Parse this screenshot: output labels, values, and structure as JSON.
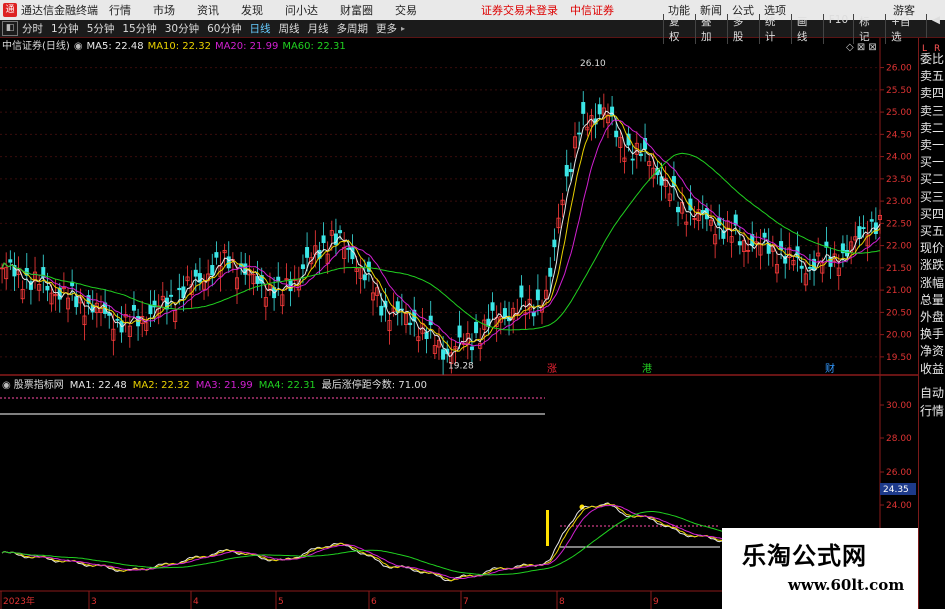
{
  "titlebar": {
    "logo": "通",
    "app_title": "通达信金融终端",
    "menus": [
      "行情",
      "市场",
      "资讯",
      "发现",
      "问小达",
      "财富圈",
      "交易"
    ],
    "warning": "证券交易未登录",
    "broker": "中信证券",
    "right_menus": [
      "功能",
      "新闻",
      "公式",
      "选项"
    ],
    "guest": "游客"
  },
  "toolbar": {
    "periods": [
      "分时",
      "1分钟",
      "5分钟",
      "15分钟",
      "30分钟",
      "60分钟",
      "日线",
      "周线",
      "月线",
      "多周期",
      "更多"
    ],
    "active_period": "日线",
    "tools": [
      "复权",
      "叠加",
      "多股",
      "统计",
      "画线",
      "F10",
      "标记",
      "+自选",
      "◀"
    ]
  },
  "main_panel": {
    "title": "中信证券(日线)",
    "ma": [
      {
        "label": "MA5: 22.48",
        "color": "#e8e8e8"
      },
      {
        "label": "MA10: 22.32",
        "color": "#e8d000"
      },
      {
        "label": "MA20: 21.99",
        "color": "#d020d0"
      },
      {
        "label": "MA60: 22.31",
        "color": "#20d020"
      }
    ],
    "y_ticks": [
      "26.00",
      "25.50",
      "25.00",
      "24.50",
      "24.00",
      "23.50",
      "23.00",
      "22.50",
      "22.00",
      "21.50",
      "21.00",
      "20.50",
      "20.00",
      "19.50"
    ],
    "ylim": [
      19.25,
      26.35
    ],
    "high_label": "26.10",
    "low_label": "19.28",
    "markers": [
      {
        "text": "涨",
        "color": "#e23"
      },
      {
        "text": "港",
        "color": "#2c2"
      },
      {
        "text": "财",
        "color": "#39f"
      }
    ]
  },
  "sub_panel": {
    "title": "股票指标网",
    "ma": [
      {
        "label": "MA1: 22.48",
        "color": "#e8e8e8"
      },
      {
        "label": "MA2: 22.32",
        "color": "#e8d000"
      },
      {
        "label": "MA3: 21.99",
        "color": "#d020d0"
      },
      {
        "label": "MA4: 22.31",
        "color": "#20d020"
      }
    ],
    "note": "最后涨停距今数: 71.00",
    "y_ticks": [
      "30.00",
      "28.00",
      "26.00",
      "24.00"
    ],
    "current_value": "24.35"
  },
  "x_axis": [
    "2023年",
    "3",
    "4",
    "5",
    "6",
    "7",
    "8",
    "9"
  ],
  "side_panel": {
    "top_left": "L",
    "top_right": "R",
    "items": [
      "委比",
      "卖五",
      "卖四",
      "卖三",
      "卖二",
      "卖一",
      "买一",
      "买二",
      "买三",
      "买四",
      "买五",
      "现价",
      "涨跌",
      "涨幅",
      "总量",
      "外盘",
      "换手",
      "净资",
      "收益",
      "自动",
      "行情"
    ]
  },
  "watermark": {
    "text": "乐淘公式网",
    "url": "www.60lt.com"
  },
  "colors": {
    "up": "#ff3c3c",
    "down": "#3ce6e6",
    "axis": "#8a1a1a",
    "grid": "#3a0c0c"
  },
  "chart_data": {
    "type": "candlestick",
    "x": [
      "2023年",
      "3",
      "4",
      "5",
      "6",
      "7",
      "8",
      "9"
    ],
    "key_points": [
      {
        "label": "low",
        "value": 19.28
      },
      {
        "label": "high",
        "value": 26.1
      }
    ],
    "series": [
      {
        "name": "MA5",
        "last": 22.48
      },
      {
        "name": "MA10",
        "last": 22.32
      },
      {
        "name": "MA20",
        "last": 21.99
      },
      {
        "name": "MA60",
        "last": 22.31
      }
    ]
  }
}
